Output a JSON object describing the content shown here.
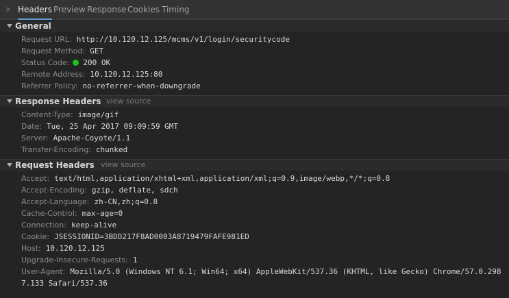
{
  "tabs": {
    "close_glyph": "×",
    "items": [
      "Headers",
      "Preview",
      "Response",
      "Cookies",
      "Timing"
    ],
    "active": "Headers"
  },
  "general": {
    "title": "General",
    "rows": [
      {
        "key": "Request URL:",
        "value": "http://10.120.12.125/mcms/v1/login/securitycode"
      },
      {
        "key": "Request Method:",
        "value": "GET"
      },
      {
        "key": "Status Code:",
        "value": "200 OK",
        "status_color": "#1ac21a"
      },
      {
        "key": "Remote Address:",
        "value": "10.120.12.125:80"
      },
      {
        "key": "Referrer Policy:",
        "value": "no-referrer-when-downgrade"
      }
    ]
  },
  "response_headers": {
    "title": "Response Headers",
    "view_source": "view source",
    "rows": [
      {
        "key": "Content-Type:",
        "value": "image/gif"
      },
      {
        "key": "Date:",
        "value": "Tue, 25 Apr 2017 09:09:59 GMT"
      },
      {
        "key": "Server:",
        "value": "Apache-Coyote/1.1"
      },
      {
        "key": "Transfer-Encoding:",
        "value": "chunked"
      }
    ]
  },
  "request_headers": {
    "title": "Request Headers",
    "view_source": "view source",
    "rows": [
      {
        "key": "Accept:",
        "value": "text/html,application/xhtml+xml,application/xml;q=0.9,image/webp,*/*;q=0.8"
      },
      {
        "key": "Accept-Encoding:",
        "value": "gzip, deflate, sdch"
      },
      {
        "key": "Accept-Language:",
        "value": "zh-CN,zh;q=0.8"
      },
      {
        "key": "Cache-Control:",
        "value": "max-age=0"
      },
      {
        "key": "Connection:",
        "value": "keep-alive"
      },
      {
        "key": "Cookie:",
        "value": "JSESSIONID=3BDD217F8AD0003A8719479FAFE981ED"
      },
      {
        "key": "Host:",
        "value": "10.120.12.125"
      },
      {
        "key": "Upgrade-Insecure-Requests:",
        "value": "1"
      },
      {
        "key": "User-Agent:",
        "value": "Mozilla/5.0 (Windows NT 6.1; Win64; x64) AppleWebKit/537.36 (KHTML, like Gecko) Chrome/57.0.2987.133 Safari/537.36"
      }
    ]
  },
  "colors": {
    "background": "#242424",
    "tab_active_underline": "#5e9ed6",
    "status_ok": "#1ac21a"
  }
}
